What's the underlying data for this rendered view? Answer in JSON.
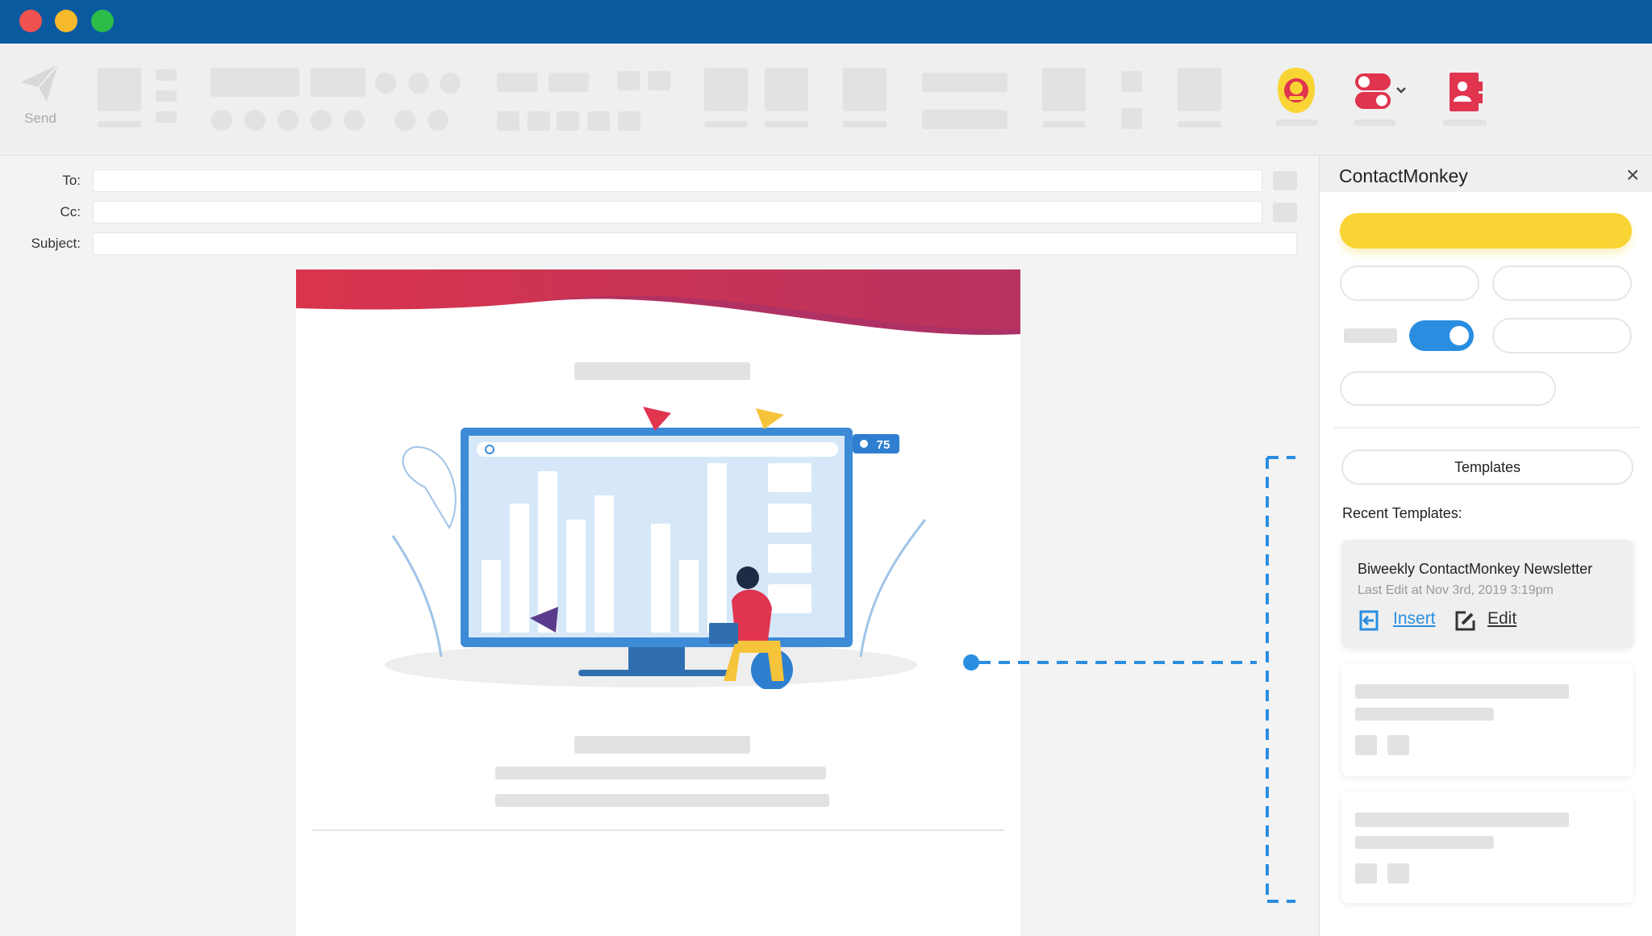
{
  "window": {
    "controls": [
      "close",
      "minimize",
      "maximize"
    ],
    "colors": {
      "titlebar": "#0a5aa0",
      "close": "#f0524f",
      "minimize": "#f6b92b",
      "maximize": "#2bbc4a"
    }
  },
  "toolbar": {
    "send_label": "Send",
    "icons": [
      "send-icon",
      "contactmonkey-logo-icon",
      "toggles-icon",
      "contacts-book-icon"
    ]
  },
  "compose": {
    "to_label": "To:",
    "cc_label": "Cc:",
    "subject_label": "Subject:",
    "to_value": "",
    "cc_value": "",
    "subject_value": ""
  },
  "email": {
    "views_badge": "75"
  },
  "panel": {
    "title": "ContactMonkey",
    "templates_button": "Templates",
    "recent_label": "Recent Templates:",
    "recent": [
      {
        "name": "Biweekly ContactMonkey Newsletter",
        "last_edit": "Last Edit at Nov 3rd, 2019 3:19pm",
        "insert_label": "Insert",
        "edit_label": "Edit"
      }
    ],
    "toggle_on": true,
    "colors": {
      "accent": "#2a8ee0",
      "primary_button": "#f8d534"
    }
  }
}
